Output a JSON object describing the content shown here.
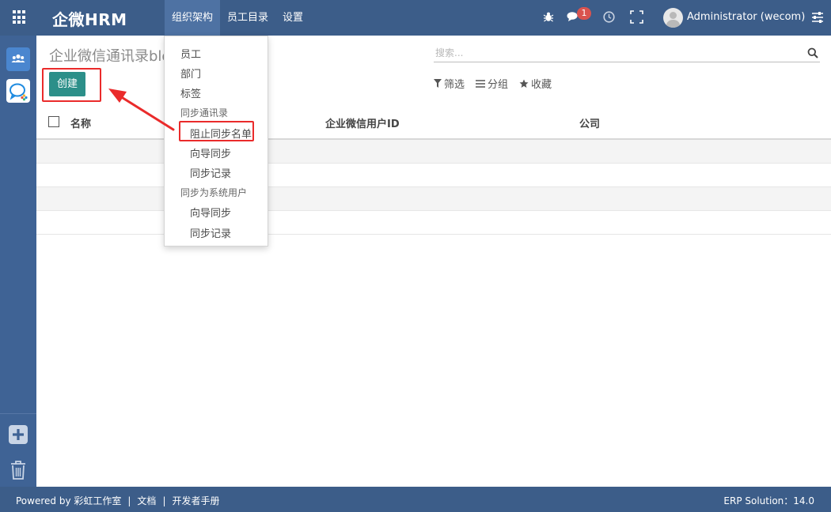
{
  "topbar": {
    "brand": "企微HRM",
    "menu": [
      "组织架构",
      "员工目录",
      "设置"
    ],
    "chat_badge": "1",
    "user_name": "Administrator (wecom)"
  },
  "control": {
    "title": "企业微信通讯录blo",
    "create_label": "创建",
    "search_placeholder": "搜索...",
    "filters": [
      "筛选",
      "分组",
      "收藏"
    ]
  },
  "table": {
    "columns": [
      "名称",
      "企业微信用户ID",
      "公司"
    ]
  },
  "dropdown": {
    "items": [
      {
        "label": "员工",
        "type": "item"
      },
      {
        "label": "部门",
        "type": "item"
      },
      {
        "label": "标签",
        "type": "item"
      },
      {
        "label": "同步通讯录",
        "type": "header"
      },
      {
        "label": "阻止同步名单",
        "type": "sub"
      },
      {
        "label": "向导同步",
        "type": "sub"
      },
      {
        "label": "同步记录",
        "type": "sub"
      },
      {
        "label": "同步为系统用户",
        "type": "header"
      },
      {
        "label": "向导同步",
        "type": "sub"
      },
      {
        "label": "同步记录",
        "type": "sub"
      }
    ]
  },
  "footer": {
    "powered_by": "Powered by 彩虹工作室",
    "docs": "文档",
    "dev_manual": "开发者手册",
    "version": "ERP Solution：14.0"
  },
  "colors": {
    "navbar": "#3c5d89",
    "create_button": "#2c8f89",
    "highlight_annotation": "#ea2b2b"
  }
}
